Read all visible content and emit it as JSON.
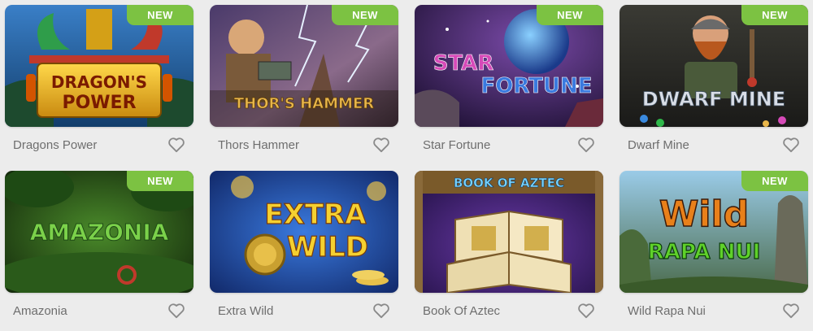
{
  "badge_label": "NEW",
  "colors": {
    "badge": "#7cc242",
    "title": "#6e6e6e",
    "heart": "#8a8a8a",
    "background": "#ececec"
  },
  "games": [
    {
      "title": "Dragons Power",
      "logo_line1": "DRAGON'S",
      "logo_line2": "POWER",
      "is_new": true
    },
    {
      "title": "Thors Hammer",
      "logo_line1": "THOR'S HAMMER",
      "is_new": true
    },
    {
      "title": "Star Fortune",
      "logo_line1": "STAR",
      "logo_line2": "FORTUNE",
      "is_new": true
    },
    {
      "title": "Dwarf Mine",
      "logo_line1": "DWARF MINE",
      "is_new": true
    },
    {
      "title": "Amazonia",
      "logo_line1": "AMAZONIA",
      "is_new": true
    },
    {
      "title": "Extra Wild",
      "logo_line1": "EXTRA",
      "logo_line2": "WILD",
      "is_new": false
    },
    {
      "title": "Book Of Aztec",
      "logo_line1": "BOOK OF AZTEC",
      "is_new": false
    },
    {
      "title": "Wild Rapa Nui",
      "logo_line1": "Wild",
      "logo_line2": "RAPA NUI",
      "is_new": true
    }
  ],
  "icons": {
    "favorite": "heart-outline-icon"
  }
}
